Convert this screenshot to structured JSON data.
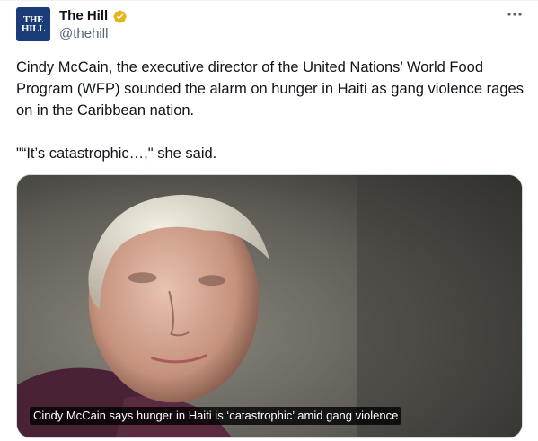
{
  "account": {
    "logo_line1": "THE",
    "logo_line2": "HILL",
    "display_name": "The Hill",
    "handle": "@thehill",
    "verified_icon": "verified-badge-icon",
    "verified_color": "#e2b719"
  },
  "more_icon": "more-horizontal-icon",
  "tweet": {
    "text_paragraph_1": "Cindy McCain, the executive director of the United Nations’ World Food Program (WFP) sounded the alarm on hunger in Haiti as gang violence rages on in the Caribbean nation.",
    "text_paragraph_2": "\"“It’s catastrophic…,\" she said."
  },
  "media": {
    "caption": "Cindy McCain says hunger in Haiti is ‘catastrophic’ amid gang violence"
  }
}
